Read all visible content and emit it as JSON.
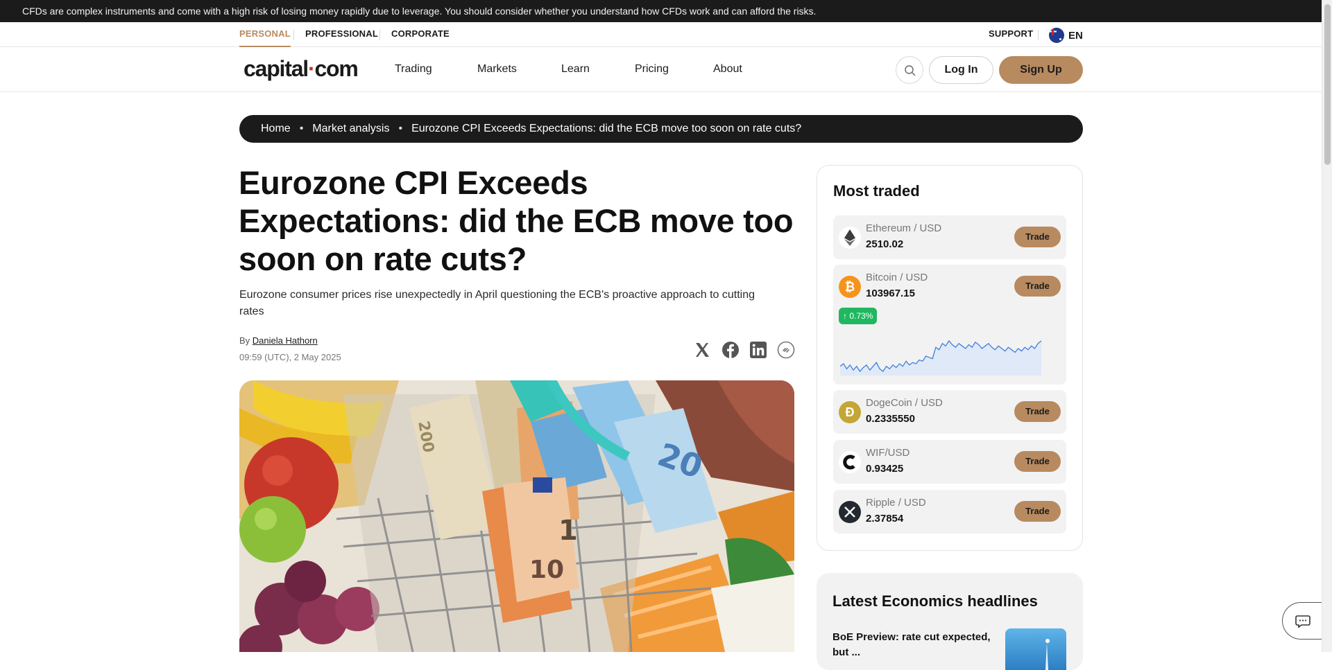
{
  "risk_banner": "CFDs are complex instruments and come with a high risk of losing money rapidly due to leverage. You should consider whether you understand how CFDs work and can afford the risks.",
  "segments": [
    "PERSONAL",
    "PROFESSIONAL",
    "CORPORATE"
  ],
  "support": "SUPPORT",
  "language": "EN",
  "logo": {
    "left": "capital",
    "dot": "·",
    "right": "com"
  },
  "nav": [
    "Trading",
    "Markets",
    "Learn",
    "Pricing",
    "About"
  ],
  "login": "Log In",
  "signup": "Sign Up",
  "breadcrumbs": [
    "Home",
    "Market analysis",
    "Eurozone CPI Exceeds Expectations: did the ECB move too soon on rate cuts?"
  ],
  "breadcrumb_sep": "•",
  "article": {
    "title": "Eurozone CPI Exceeds Expectations: did the ECB move too soon on rate cuts?",
    "subtitle": "Eurozone consumer prices rise unexpectedly in April questioning the ECB's proactive approach to cutting rates",
    "by": "By",
    "author": "Daniela Hathorn",
    "date": "09:59 (UTC), 2 May 2025"
  },
  "share_icons": [
    "x-icon",
    "facebook-icon",
    "linkedin-icon",
    "copy-link-icon"
  ],
  "most_traded": {
    "title": "Most traded",
    "trade_label": "Trade",
    "items": [
      {
        "pair": "Ethereum / USD",
        "price": "2510.02",
        "icon": "ethereum-icon",
        "color": "#ffffff"
      },
      {
        "pair": "Bitcoin / USD",
        "price": "103967.15",
        "icon": "bitcoin-icon",
        "color": "#f7931a",
        "change": "↑ 0.73%",
        "sparkline": [
          40,
          42,
          38,
          41,
          37,
          40,
          36,
          39,
          41,
          37,
          40,
          43,
          38,
          36,
          40,
          38,
          41,
          39,
          42,
          40,
          44,
          41,
          43,
          42,
          45,
          44,
          48,
          47,
          46,
          55,
          53,
          58,
          56,
          60,
          57,
          55,
          58,
          56,
          54,
          57,
          55,
          59,
          57,
          54,
          56,
          58,
          55,
          53,
          56,
          54,
          52,
          55,
          53,
          51,
          54,
          52,
          55,
          53,
          56,
          54,
          58,
          60
        ]
      },
      {
        "pair": "DogeCoin / USD",
        "price": "0.2335550",
        "icon": "dogecoin-icon",
        "color": "#c3a634"
      },
      {
        "pair": "WIF/USD",
        "price": "0.93425",
        "icon": "wif-icon",
        "color": "#111111"
      },
      {
        "pair": "Ripple / USD",
        "price": "2.37854",
        "icon": "ripple-icon",
        "color": "#23292f"
      }
    ]
  },
  "headlines": {
    "title": "Latest Economics headlines",
    "first": "BoE Preview: rate cut expected, but ..."
  },
  "colors": {
    "accent": "#b88a60",
    "dark": "#1b1b1b",
    "positive": "#1fb860"
  }
}
